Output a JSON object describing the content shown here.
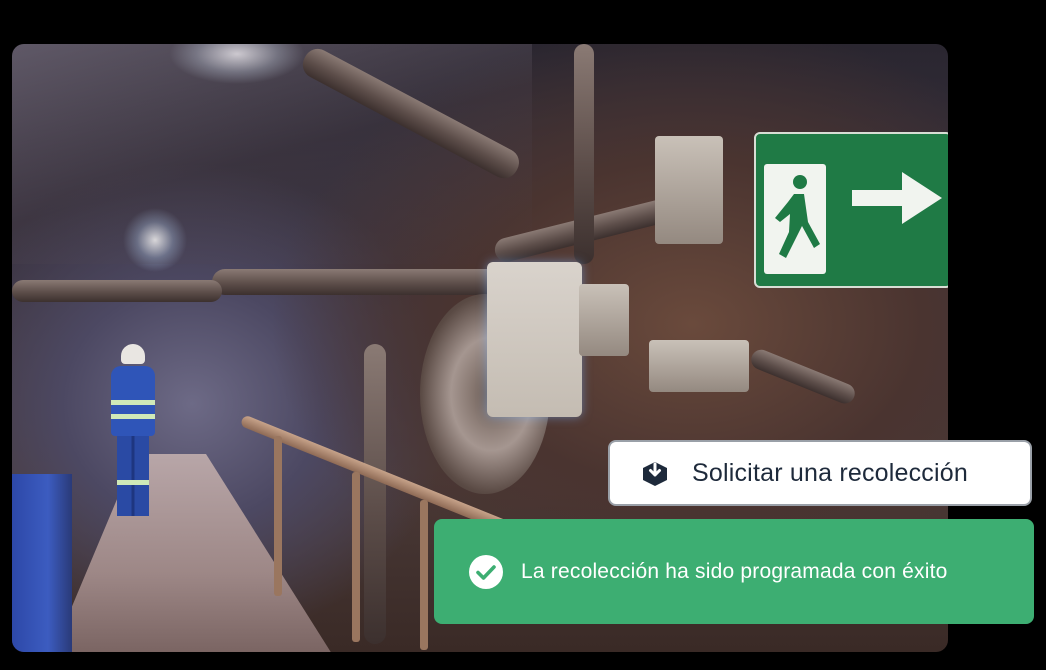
{
  "actions": {
    "request_pickup_label": "Solicitar una recolección"
  },
  "notification": {
    "message": "La recolección ha sido programada con éxito",
    "status": "success"
  },
  "icons": {
    "request": "package-download-icon",
    "success": "check-circle-icon"
  },
  "colors": {
    "success": "#3dae72",
    "button_text": "#1e2a3b",
    "button_border": "#9aa0a8"
  }
}
